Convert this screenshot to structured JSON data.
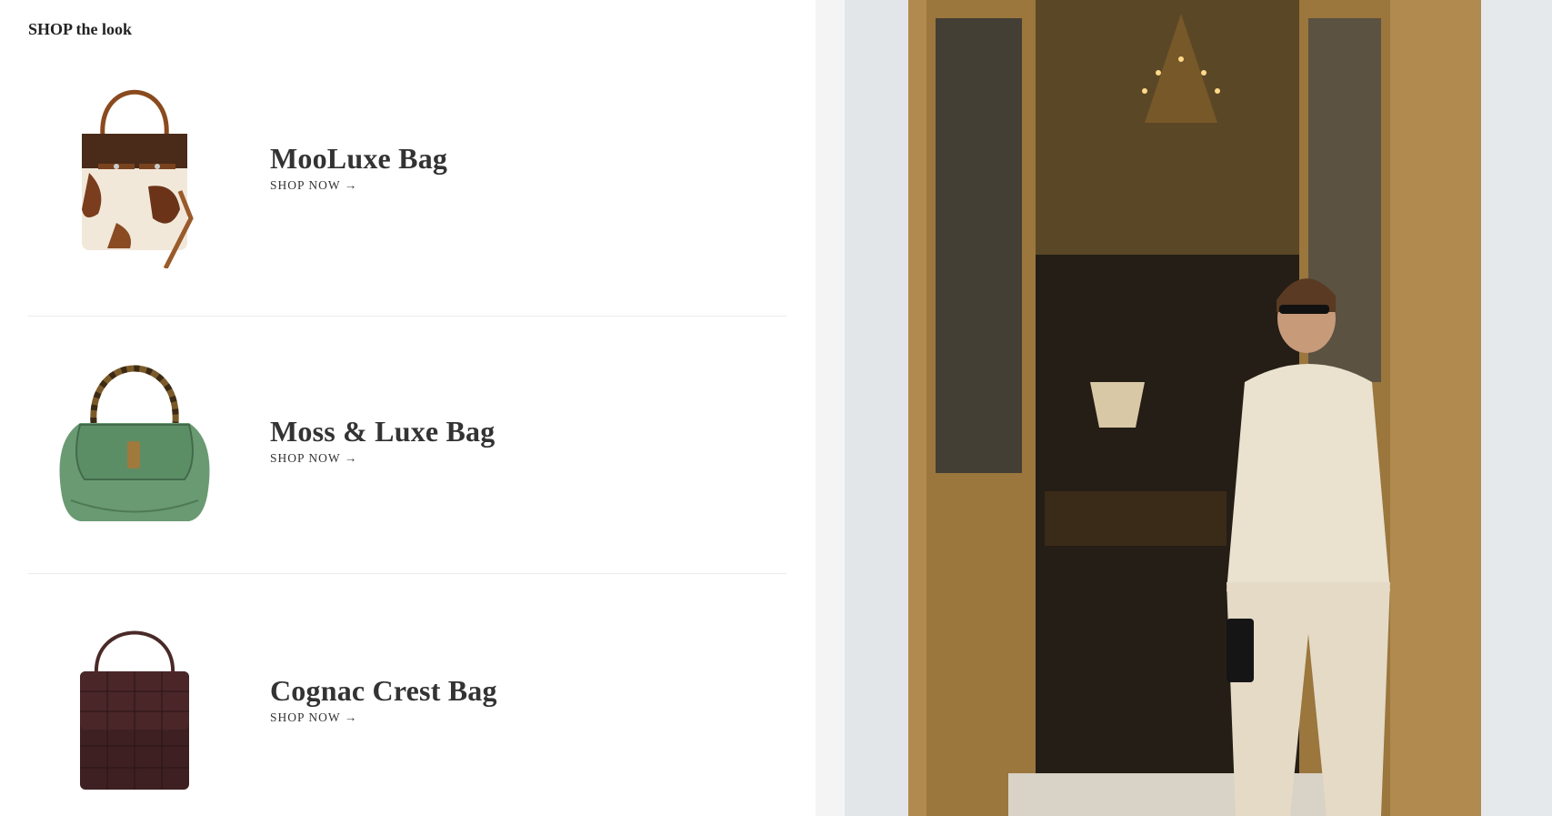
{
  "section": {
    "title": "SHOP the look"
  },
  "products": [
    {
      "name": "MooLuxe Bag",
      "cta": "SHOP NOW →",
      "icon": "cowhide-bag-image"
    },
    {
      "name": "Moss & Luxe Bag",
      "cta": "SHOP NOW →",
      "icon": "green-croc-bag-image"
    },
    {
      "name": "Cognac Crest Bag",
      "cta": "SHOP NOW →",
      "icon": "brown-croc-bag-image"
    }
  ],
  "colors": {
    "background": "#ffffff",
    "gutter": "#f4f4f4",
    "divider": "#ebebeb",
    "text": "#333333"
  }
}
